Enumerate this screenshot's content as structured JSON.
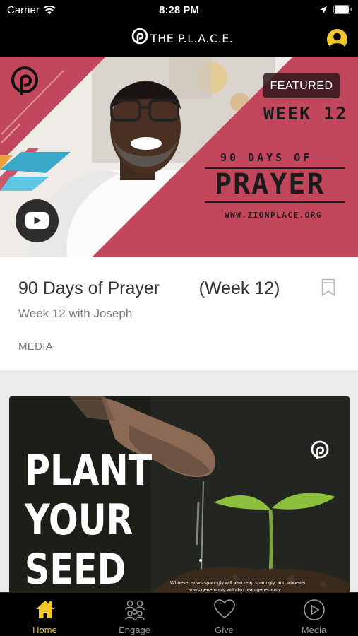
{
  "status_bar": {
    "carrier": "Carrier",
    "time": "8:28 PM"
  },
  "header": {
    "app_title": "THE P.L.A.C.E.",
    "profile_icon": "user-circle-icon"
  },
  "featured": {
    "badge": "FEATURED",
    "graphic": {
      "week": "WEEK 12",
      "top_line": "90 DAYS OF",
      "headline": "PRAYER",
      "url": "WWW.ZIONPLACE.ORG"
    },
    "play_icon": "youtube-icon",
    "title": "90 Days of Prayer        (Week 12)",
    "subtitle": "Week 12 with Joseph",
    "category": "MEDIA",
    "bookmark_icon": "bookmark-icon"
  },
  "second_card": {
    "headline_lines": [
      "PLANT",
      "YOUR",
      "SEED"
    ],
    "verse_line_1": "Whoever sows sparingly will also reap sparingly, and whoever",
    "verse_line_2": "sows generously will also reap generously"
  },
  "tabs": [
    {
      "label": "Home",
      "icon": "home-icon",
      "active": true
    },
    {
      "label": "Engage",
      "icon": "people-icon",
      "active": false
    },
    {
      "label": "Give",
      "icon": "heart-icon",
      "active": false
    },
    {
      "label": "Media",
      "icon": "play-circle-icon",
      "active": false
    }
  ],
  "colors": {
    "accent": "#f2c72a",
    "brand_red": "#c2475d",
    "header_bg": "#000000"
  }
}
